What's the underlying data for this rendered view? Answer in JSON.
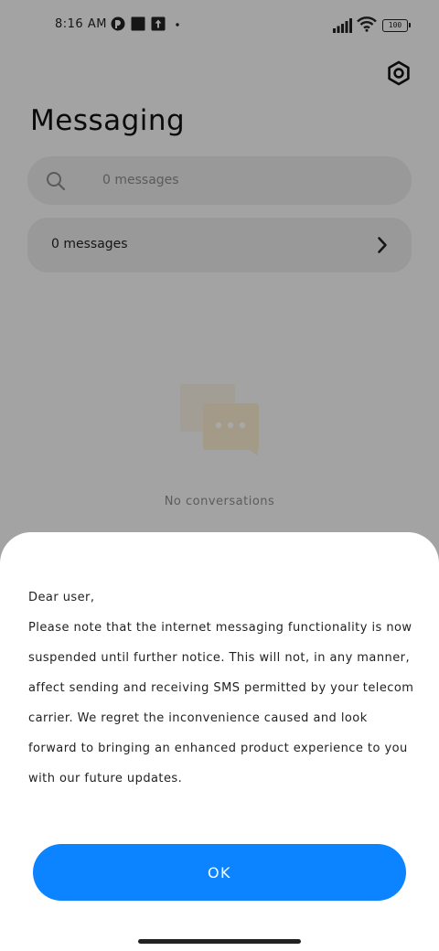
{
  "status_bar": {
    "time": "8:16 AM",
    "battery": "100"
  },
  "header": {
    "title": "Messaging",
    "settings_icon": "gear-icon"
  },
  "search": {
    "placeholder": "0 messages",
    "icon": "search-icon"
  },
  "summary_card": {
    "label": "0 messages",
    "icon": "chevron-right-icon"
  },
  "empty_state": {
    "icon": "chat-bubbles-icon",
    "text": "No conversations"
  },
  "dialog": {
    "lines": [
      "Dear user,",
      "Please note that the internet messaging functionality is now",
      "suspended until further notice. This will not, in any manner,",
      "affect sending and receiving SMS permitted by your telecom",
      "carrier. We regret the inconvenience caused and look",
      "forward to bringing an enhanced product experience to you",
      "with our future updates."
    ],
    "ok_label": "OK"
  },
  "colors": {
    "accent": "#0d84ff",
    "scrim": "rgba(0,0,0,0.34)"
  }
}
